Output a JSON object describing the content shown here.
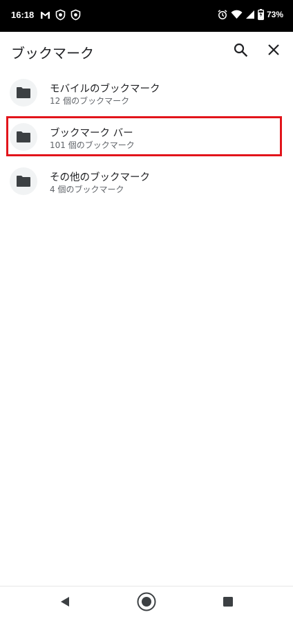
{
  "status_bar": {
    "time": "16:18",
    "battery_percent": "73%"
  },
  "app_bar": {
    "title": "ブックマーク",
    "search_icon": "search-icon",
    "close_icon": "close-icon"
  },
  "folders": [
    {
      "title": "モバイルのブックマーク",
      "subtitle": "12 個のブックマーク",
      "icon": "folder-icon"
    },
    {
      "title": "ブックマーク バー",
      "subtitle": "101 個のブックマーク",
      "icon": "folder-icon",
      "highlighted": true
    },
    {
      "title": "その他のブックマーク",
      "subtitle": "4 個のブックマーク",
      "icon": "folder-icon"
    }
  ],
  "colors": {
    "highlight": "#e2141b",
    "folder_icon": "#3c4043",
    "icon_circle_bg": "#f1f3f4"
  }
}
